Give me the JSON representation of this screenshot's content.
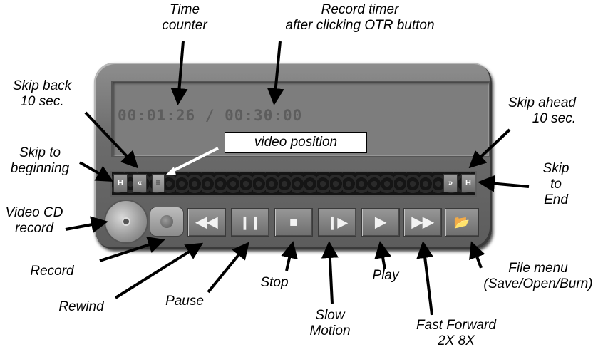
{
  "display": {
    "time_counter": "00:01:26",
    "separator": "/",
    "record_timer": "00:30:00"
  },
  "video_position_label": "video position",
  "controls": {
    "skip_to_beginning_glyph": "H",
    "skip_back_glyph": "«",
    "slider_glyph": "≡",
    "skip_ahead_glyph": "»",
    "skip_to_end_glyph": "H",
    "rewind_glyph": "◀◀",
    "pause_glyph": "❙❙",
    "stop_glyph": "■",
    "slow_motion_glyph": "❙▶",
    "play_glyph": "▶",
    "fast_forward_glyph": "▶▶",
    "file_menu_glyph": "📂"
  },
  "callouts": {
    "time_counter": "Time\ncounter",
    "record_timer": "Record timer\nafter clicking OTR button",
    "skip_back": "Skip back\n10 sec.",
    "skip_ahead": "Skip ahead\n10 sec.",
    "skip_to_beginning": "Skip to\nbeginning",
    "skip_to_end": "Skip\nto\nEnd",
    "video_cd_record": "Video CD\nrecord",
    "record": "Record",
    "rewind": "Rewind",
    "pause": "Pause",
    "stop": "Stop",
    "slow_motion": "Slow\nMotion",
    "play": "Play",
    "fast_forward": "Fast Forward\n2X 8X",
    "file_menu": "File menu\n(Save/Open/Burn)"
  }
}
